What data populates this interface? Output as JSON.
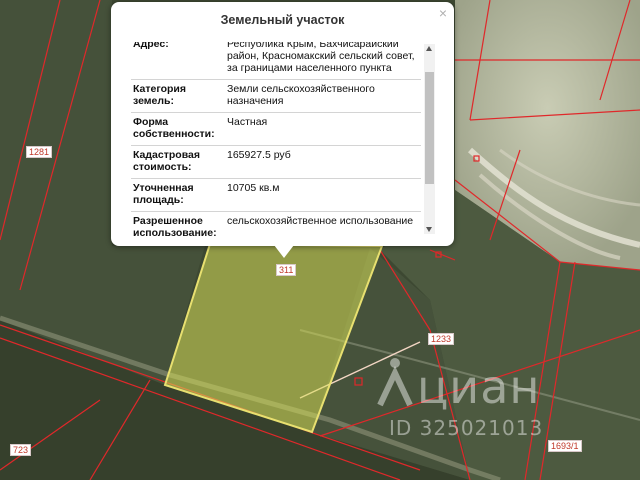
{
  "popup": {
    "title": "Земельный участок",
    "close_icon": "×",
    "rows": [
      {
        "label": "Адрес:",
        "value": "Республика Крым, Бахчисарайский район, Красномакский сельский совет, за границами населенного пункта"
      },
      {
        "label": "Категория земель:",
        "value": "Земли сельскохозяйственного назначения"
      },
      {
        "label": "Форма собственности:",
        "value": "Частная"
      },
      {
        "label": "Кадастровая стоимость:",
        "value": "165927.5 руб"
      },
      {
        "label": "Уточненная площадь:",
        "value": "10705 кв.м"
      },
      {
        "label": "Разрешенное использование:",
        "value": "сельскохозяйственное использование"
      }
    ]
  },
  "parcel_labels": {
    "l311": "311",
    "l1281": "1281",
    "l1233": "1233",
    "l723": "723",
    "l1693": "1693/1"
  },
  "watermark": {
    "brand": "циан",
    "id": "ID 325021013"
  },
  "colors": {
    "boundary": "#e0282a",
    "selected_fill": "#d9e05a",
    "selected_outline": "#e8e070"
  }
}
